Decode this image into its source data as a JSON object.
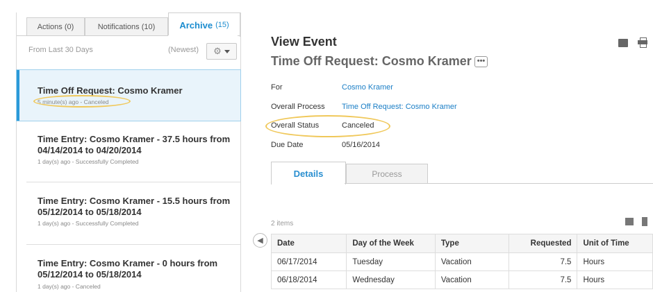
{
  "tabs": [
    {
      "label": "Actions",
      "count": "(0)"
    },
    {
      "label": "Notifications",
      "count": "(10)"
    },
    {
      "label": "Archive",
      "count": "(15)"
    }
  ],
  "filter": {
    "range": "From Last 30 Days",
    "sort": "(Newest)"
  },
  "list": [
    {
      "title": "Time Off Request: Cosmo Kramer",
      "subtitle": "5 minute(s) ago - Canceled"
    },
    {
      "title": "Time Entry: Cosmo Kramer - 37.5 hours from 04/14/2014 to 04/20/2014",
      "subtitle": "1 day(s) ago - Successfully Completed"
    },
    {
      "title": "Time Entry: Cosmo Kramer - 15.5 hours from 05/12/2014 to 05/18/2014",
      "subtitle": "1 day(s) ago - Successfully Completed"
    },
    {
      "title": "Time Entry: Cosmo Kramer - 0 hours from 05/12/2014 to 05/18/2014",
      "subtitle": "1 day(s) ago - Canceled"
    }
  ],
  "event": {
    "heading": "View Event",
    "title": "Time Off Request: Cosmo Kramer",
    "more": "•••",
    "fields": [
      {
        "label": "For",
        "value": "Cosmo Kramer"
      },
      {
        "label": "Overall Process",
        "value": "Time Off Request: Cosmo Kramer"
      },
      {
        "label": "Overall Status",
        "value": "Canceled"
      },
      {
        "label": "Due Date",
        "value": "05/16/2014"
      }
    ]
  },
  "detail_tabs": {
    "details": "Details",
    "process": "Process"
  },
  "grid": {
    "count": "2 items",
    "headers": [
      "Date",
      "Day of the Week",
      "Type",
      "Requested",
      "Unit of Time"
    ],
    "rows": [
      [
        "06/17/2014",
        "Tuesday",
        "Vacation",
        "7.5",
        "Hours"
      ],
      [
        "06/18/2014",
        "Wednesday",
        "Vacation",
        "7.5",
        "Hours"
      ]
    ]
  },
  "icons": {
    "settings": "gear-icon",
    "export": "excel-icon",
    "print": "print-icon",
    "collapse": "arrow-left-icon"
  },
  "colors": {
    "accent": "#1b8ccf",
    "selected_bg": "#e9f4fb",
    "highlight": "#f0c85a"
  }
}
